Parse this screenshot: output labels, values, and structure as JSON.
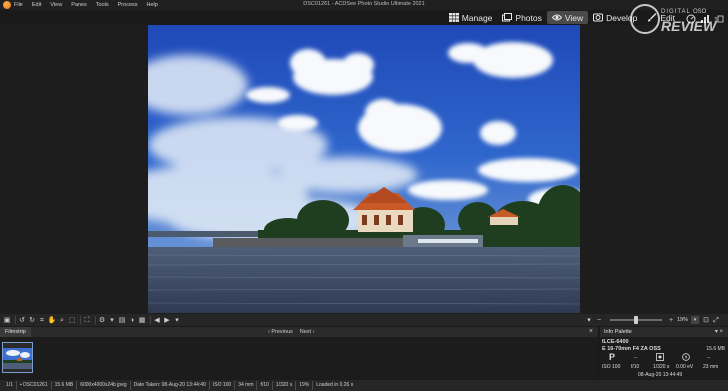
{
  "window_title": "DSC01261 - ACDSee Photo Studio Ultimate 2021",
  "menu": [
    "File",
    "Edit",
    "View",
    "Panes",
    "Tools",
    "Process",
    "Help"
  ],
  "modes": [
    {
      "label": "Manage",
      "icon": "grid-icon"
    },
    {
      "label": "Photos",
      "icon": "photos-icon"
    },
    {
      "label": "View",
      "icon": "eye-icon"
    },
    {
      "label": "Develop",
      "icon": "develop-icon"
    },
    {
      "label": "Edit",
      "icon": "brush-icon"
    }
  ],
  "active_mode": "View",
  "toolbar": {
    "zoom_value": "19%",
    "zoom_dropdown": "▾",
    "zoom_fraction": 0.5
  },
  "filmstrip": {
    "tab_label": "Filmstrip",
    "previous_label": "Previous",
    "next_label": "Next",
    "close_label": "×"
  },
  "info_palette": {
    "title": "Info Palette",
    "header_icons": "▾ ×",
    "camera": "ILCE-6400",
    "lens": "E 16-70mm F4 ZA OSS",
    "file_size": "15.6 MB",
    "exposure_mode": "P",
    "dash1": "--",
    "dash2": "--",
    "iso": "ISO 100",
    "aperture": "f/10",
    "shutter": "1/320 s",
    "exposure_comp": "0.00 eV",
    "focal_length": "23 mm",
    "date": "08-Aug-20 13:44:49"
  },
  "status": {
    "index": "1/1",
    "filename": "DSC01261",
    "size": "15.6 MB",
    "dimensions": "6000x4000x24b jpeg",
    "date_taken": "Date Taken: 08-Aug-20 13:44:49",
    "iso": "ISO 100",
    "focal": "34 mm",
    "aperture": "f/10",
    "shutter": "1/320 s",
    "zoom": "19%",
    "loaded": "Loaded in 0.26 s"
  },
  "watermark": {
    "brand_top": "DIGITAL",
    "brand_bottom": "REVIEW",
    "brand_mid": "OSO"
  },
  "colors": {
    "active_tab": "#4a4a4a",
    "accent": "#7a9ccf"
  }
}
